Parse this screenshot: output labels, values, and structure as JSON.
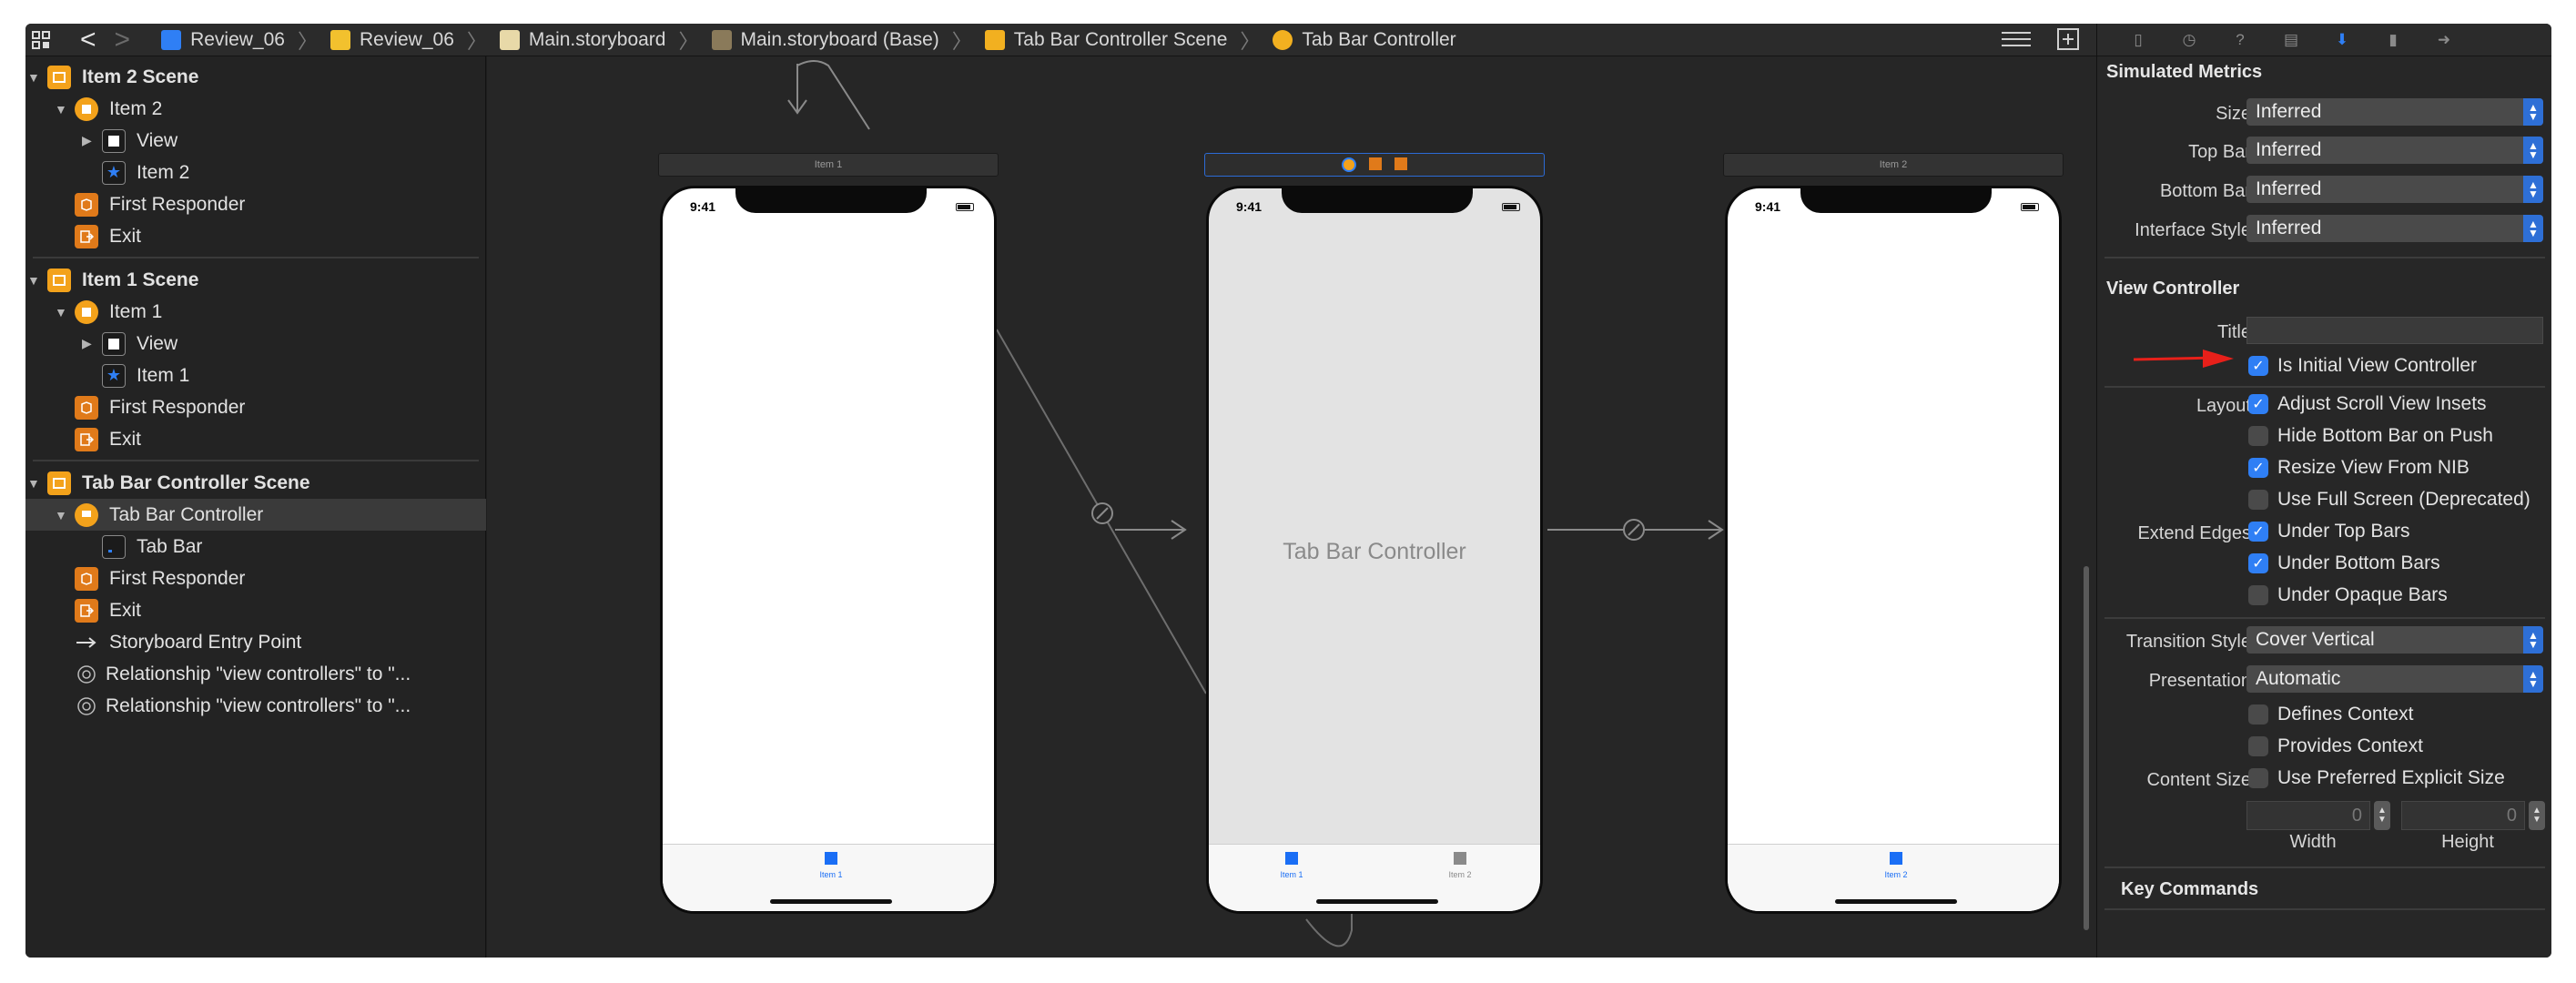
{
  "jumpbar": {
    "crumbs": [
      "Review_06",
      "Review_06",
      "Main.storyboard",
      "Main.storyboard (Base)",
      "Tab Bar Controller Scene",
      "Tab Bar Controller"
    ],
    "back_glyph": "<",
    "forward_glyph": ">",
    "separator": "〉"
  },
  "outline": {
    "item2_scene": "Item 2 Scene",
    "item2_vc": "Item 2",
    "item2_view": "View",
    "item2_tab": "Item 2",
    "item2_responder": "First Responder",
    "item2_exit": "Exit",
    "item1_scene": "Item 1 Scene",
    "item1_vc": "Item 1",
    "item1_view": "View",
    "item1_tab": "Item 1",
    "item1_responder": "First Responder",
    "item1_exit": "Exit",
    "tbc_scene": "Tab Bar Controller Scene",
    "tbc": "Tab Bar Controller",
    "tbc_tabbar": "Tab Bar",
    "tbc_responder": "First Responder",
    "tbc_exit": "Exit",
    "entry_point": "Storyboard Entry Point",
    "rel1": "Relationship \"view controllers\" to \"...",
    "rel2": "Relationship \"view controllers\" to \"..."
  },
  "canvas": {
    "left_scene": {
      "title": "Item 1",
      "time": "9:41",
      "tabs": [
        {
          "label": "Item 1",
          "selected": true
        }
      ]
    },
    "center_scene": {
      "title": "",
      "time": "9:41",
      "label": "Tab Bar Controller",
      "tabs": [
        {
          "label": "Item 1",
          "selected": true
        },
        {
          "label": "Item 2",
          "selected": false
        }
      ]
    },
    "right_scene": {
      "title": "Item 2",
      "time": "9:41",
      "tabs": [
        {
          "label": "Item 2",
          "selected": true
        }
      ]
    }
  },
  "inspector": {
    "simulated_metrics": "Simulated Metrics",
    "size_label": "Size",
    "size_value": "Inferred",
    "topbar_label": "Top Bar",
    "topbar_value": "Inferred",
    "bottombar_label": "Bottom Bar",
    "bottombar_value": "Inferred",
    "interface_style_label": "Interface Style",
    "interface_style_value": "Inferred",
    "view_controller": "View Controller",
    "title_label": "Title",
    "is_initial": "Is Initial View Controller",
    "layout_label": "Layout",
    "adjust_scroll": "Adjust Scroll View Insets",
    "hide_bottom_bar": "Hide Bottom Bar on Push",
    "resize_view": "Resize View From NIB",
    "use_full_screen": "Use Full Screen (Deprecated)",
    "extend_edges_label": "Extend Edges",
    "under_top_bars": "Under Top Bars",
    "under_bottom_bars": "Under Bottom Bars",
    "under_opaque_bars": "Under Opaque Bars",
    "transition_style_label": "Transition Style",
    "transition_style_value": "Cover Vertical",
    "presentation_label": "Presentation",
    "presentation_value": "Automatic",
    "defines_context": "Defines Context",
    "provides_context": "Provides Context",
    "content_size_label": "Content Size",
    "use_preferred_size": "Use Preferred Explicit Size",
    "width_value": "0",
    "height_value": "0",
    "width_label": "Width",
    "height_label": "Height",
    "key_commands": "Key Commands"
  },
  "colors": {
    "accent": "#2f7ff5",
    "arrow": "#e8201a",
    "canvas_bg": "#262626"
  }
}
